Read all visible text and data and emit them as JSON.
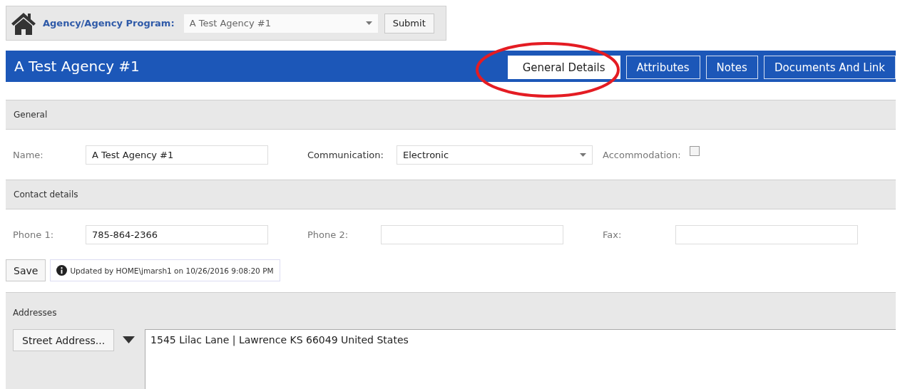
{
  "toolbar": {
    "label": "Agency/Agency Program:",
    "program": "A Test Agency #1",
    "submit": "Submit"
  },
  "header": {
    "title": "A Test Agency #1",
    "tabs": [
      {
        "label": "General Details",
        "selected": true
      },
      {
        "label": "Attributes",
        "selected": false
      },
      {
        "label": "Notes",
        "selected": false
      },
      {
        "label": "Documents And Link",
        "selected": false
      }
    ]
  },
  "general": {
    "heading": "General",
    "fields": [
      {
        "kind": "text",
        "label": "Name:",
        "value": "A Test Agency #1"
      },
      {
        "kind": "select",
        "label": "Communication:",
        "value": "Electronic"
      },
      {
        "kind": "checkbox",
        "label": "Accommodation:",
        "checked": false
      }
    ]
  },
  "contact": {
    "heading": "Contact details",
    "fields": [
      {
        "kind": "text",
        "label": "Phone 1:",
        "value": "785-864-2366"
      },
      {
        "kind": "text",
        "label": "Phone 2:"
      },
      {
        "kind": "text",
        "label": "Fax:"
      }
    ]
  },
  "actions": {
    "save": "Save",
    "update_note": "Updated by HOME\\jmarsh1 on 10/26/2016 9:08:20 PM"
  },
  "addresses": {
    "heading": "Addresses",
    "type_button": "Street Address...",
    "address": "1545 Lilac Lane | Lawrence KS 66049 United States"
  }
}
